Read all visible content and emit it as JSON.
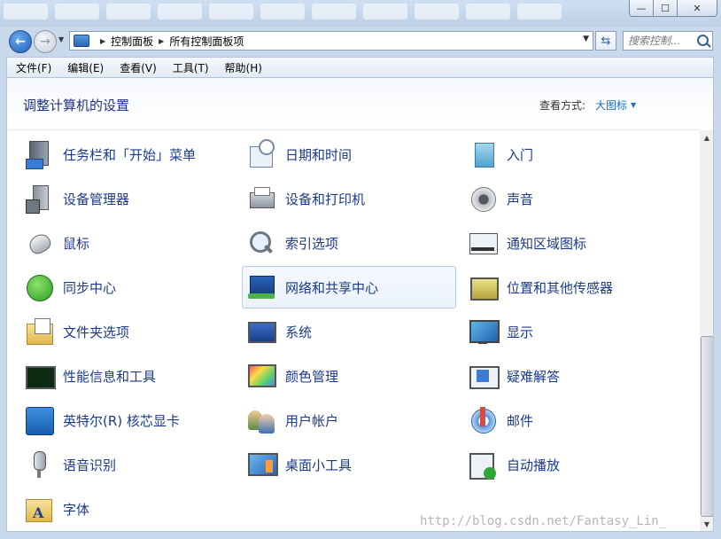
{
  "window": {
    "minimize_glyph": "—",
    "maximize_glyph": "☐",
    "close_glyph": "✕"
  },
  "address": {
    "crumbs": [
      "控制面板",
      "所有控制面板项"
    ],
    "search_placeholder": "搜索控制..."
  },
  "menu": [
    "文件(F)",
    "编辑(E)",
    "查看(V)",
    "工具(T)",
    "帮助(H)"
  ],
  "header": {
    "title": "调整计算机的设置",
    "view_label": "查看方式:",
    "view_value": "大图标"
  },
  "items": [
    {
      "label": "任务栏和「开始」菜单",
      "icon": "taskbar-icon"
    },
    {
      "label": "日期和时间",
      "icon": "date-time-icon"
    },
    {
      "label": "入门",
      "icon": "getting-started-icon"
    },
    {
      "label": "设备管理器",
      "icon": "device-manager-icon"
    },
    {
      "label": "设备和打印机",
      "icon": "printer-icon"
    },
    {
      "label": "声音",
      "icon": "sound-icon"
    },
    {
      "label": "鼠标",
      "icon": "mouse-icon"
    },
    {
      "label": "索引选项",
      "icon": "indexing-icon"
    },
    {
      "label": "通知区域图标",
      "icon": "notification-icon"
    },
    {
      "label": "同步中心",
      "icon": "sync-icon"
    },
    {
      "label": "网络和共享中心",
      "icon": "network-icon"
    },
    {
      "label": "位置和其他传感器",
      "icon": "location-icon"
    },
    {
      "label": "文件夹选项",
      "icon": "folder-icon"
    },
    {
      "label": "系统",
      "icon": "system-icon"
    },
    {
      "label": "显示",
      "icon": "display-icon"
    },
    {
      "label": "性能信息和工具",
      "icon": "performance-icon"
    },
    {
      "label": "颜色管理",
      "icon": "color-icon"
    },
    {
      "label": "疑难解答",
      "icon": "troubleshoot-icon"
    },
    {
      "label": "英特尔(R) 核芯显卡",
      "icon": "intel-graphics-icon"
    },
    {
      "label": "用户帐户",
      "icon": "user-accounts-icon"
    },
    {
      "label": "邮件",
      "icon": "mail-icon"
    },
    {
      "label": "语音识别",
      "icon": "microphone-icon"
    },
    {
      "label": "桌面小工具",
      "icon": "gadgets-icon"
    },
    {
      "label": "自动播放",
      "icon": "autoplay-icon"
    },
    {
      "label": "字体",
      "icon": "font-icon"
    }
  ],
  "selected_item": "网络和共享中心",
  "watermark": "http://blog.csdn.net/Fantasy_Lin_",
  "colors": {
    "link_blue": "#1a3a8c",
    "title_blue": "#1e3287",
    "view_link": "#1b6dc2"
  }
}
